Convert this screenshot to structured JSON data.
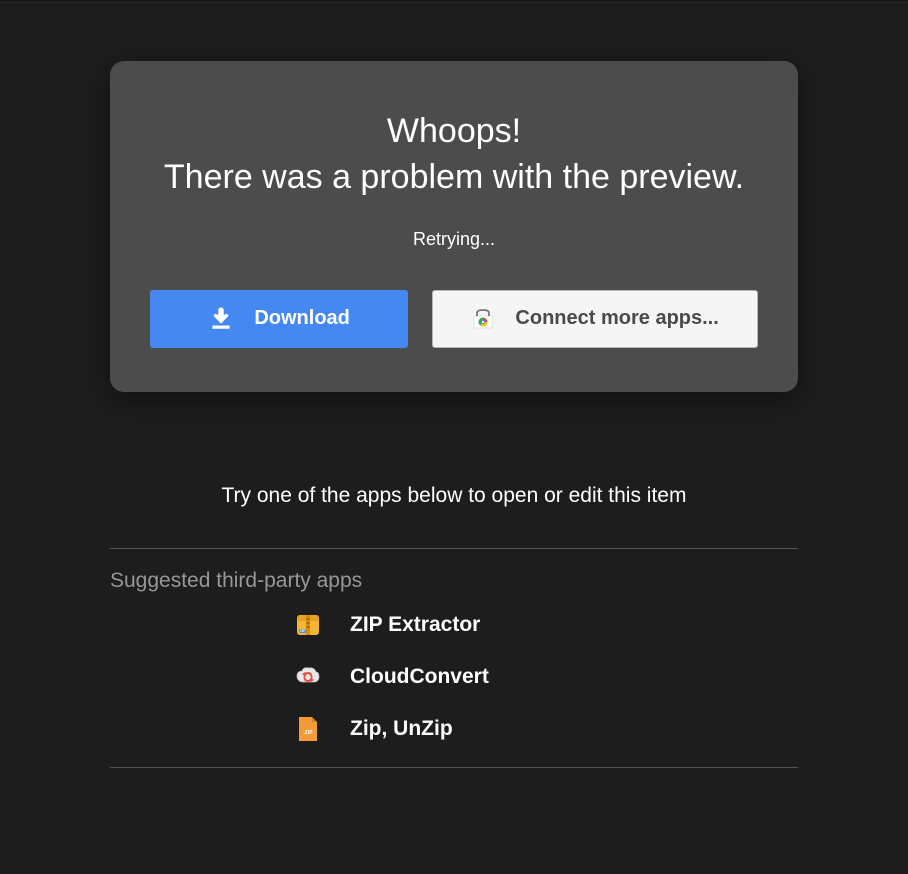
{
  "error": {
    "title_line1": "Whoops!",
    "title_line2": "There was a problem with the preview.",
    "status": "Retrying...",
    "download_label": "Download",
    "connect_label": "Connect more apps..."
  },
  "suggestions": {
    "title": "Try one of the apps below to open or edit this item",
    "section_label": "Suggested third-party apps",
    "apps": [
      {
        "name": "ZIP Extractor",
        "icon": "zip-extractor"
      },
      {
        "name": "CloudConvert",
        "icon": "cloudconvert"
      },
      {
        "name": "Zip, UnZip",
        "icon": "zip-unzip"
      }
    ]
  }
}
